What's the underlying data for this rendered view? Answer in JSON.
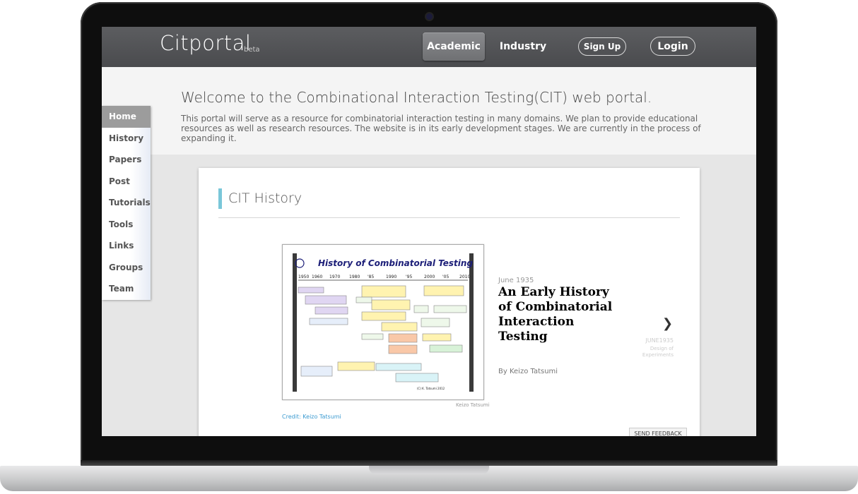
{
  "header": {
    "brand": "Citportal",
    "brand_sub": "beta",
    "nav": {
      "academic": "Academic",
      "industry": "Industry",
      "signup": "Sign Up",
      "login": "Login"
    }
  },
  "welcome": {
    "title": "Welcome to the Combinational Interaction Testing(CIT) web portal.",
    "text": "This portal will serve as a resource for combinatorial interaction testing in many domains. We plan to provide educational resources as well as research resources. The website is in its early development stages. We are currently in the process of expanding it."
  },
  "sidebar": {
    "items": [
      {
        "label": "Home",
        "active": true
      },
      {
        "label": "History"
      },
      {
        "label": "Papers"
      },
      {
        "label": "Post"
      },
      {
        "label": "Tutorials"
      },
      {
        "label": "Tools"
      },
      {
        "label": "Links"
      },
      {
        "label": "Groups"
      },
      {
        "label": "Team"
      }
    ]
  },
  "section": {
    "title": "CIT History",
    "accent_color": "#7ac7d9"
  },
  "slide": {
    "image_title": "History of Combinatorial Testing",
    "image_caption": "Keizo Tatsumi",
    "credit": "Credit: Keizo Tatsumi",
    "date": "June 1935",
    "title": "An Early History of Combinatorial Interaction Testing",
    "author": "By Keizo Tatsumi",
    "next_date": "JUNE1935",
    "next_sub": "Design of Experiments"
  },
  "feedback": "SEND FEEDBACK",
  "icons": {
    "next": "chevron-right-icon"
  }
}
